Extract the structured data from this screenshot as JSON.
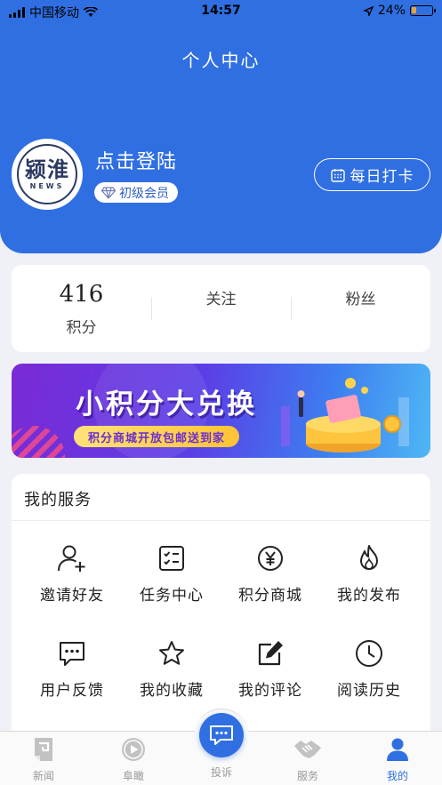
{
  "status_bar": {
    "carrier": "中国移动",
    "time": "14:57",
    "battery": "24%"
  },
  "header": {
    "title": "个人中心"
  },
  "profile": {
    "logo_text": "颍淮",
    "logo_subtext": "NEWS",
    "login_text": "点击登陆",
    "member_level": "初级会员",
    "checkin_label": "每日打卡"
  },
  "stats": [
    {
      "value": "416",
      "label": "积分"
    },
    {
      "label": "关注"
    },
    {
      "label": "粉丝"
    }
  ],
  "banner": {
    "title": "小积分大兑换",
    "subtitle": "积分商城开放包邮送到家"
  },
  "services": {
    "title": "我的服务",
    "items": [
      {
        "label": "邀请好友",
        "icon": "user-plus-icon"
      },
      {
        "label": "任务中心",
        "icon": "task-list-icon"
      },
      {
        "label": "积分商城",
        "icon": "yen-coin-icon"
      },
      {
        "label": "我的发布",
        "icon": "flame-icon"
      },
      {
        "label": "用户反馈",
        "icon": "chat-bubble-icon"
      },
      {
        "label": "我的收藏",
        "icon": "star-icon"
      },
      {
        "label": "我的评论",
        "icon": "edit-icon"
      },
      {
        "label": "阅读历史",
        "icon": "clock-icon"
      }
    ]
  },
  "tabbar": {
    "items": [
      {
        "label": "新闻",
        "icon": "news-icon"
      },
      {
        "label": "阜瞰",
        "icon": "play-icon"
      },
      {
        "label": "投诉",
        "icon": "complaint-icon"
      },
      {
        "label": "服务",
        "icon": "handshake-icon"
      },
      {
        "label": "我的",
        "icon": "person-icon"
      }
    ],
    "active": "我的"
  },
  "colors": {
    "brand": "#2f6fe2",
    "background": "#eff1f6"
  }
}
